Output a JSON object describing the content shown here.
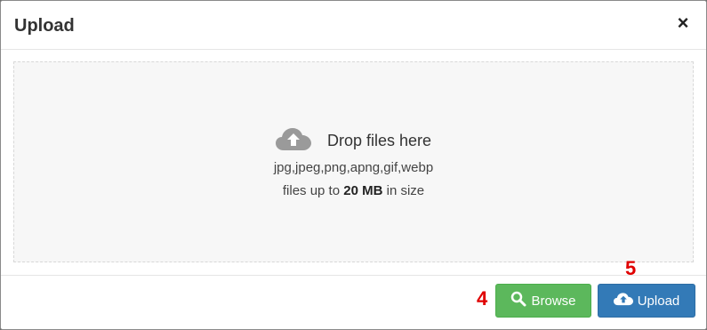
{
  "dialog": {
    "title": "Upload",
    "close_label": "×"
  },
  "dropzone": {
    "icon": "cloud-upload-icon",
    "title": "Drop files here",
    "formats": "jpg,jpeg,png,apng,gif,webp",
    "size_prefix": "files up to",
    "size_value": "20 MB",
    "size_suffix": "in size"
  },
  "buttons": {
    "browse_label": "Browse",
    "browse_icon": "search-icon",
    "browse_color": "#5cb85c",
    "upload_label": "Upload",
    "upload_icon": "cloud-upload-icon",
    "upload_color": "#337ab7"
  },
  "markers": {
    "browse_marker": "4",
    "upload_marker": "5",
    "marker_color": "#e00000"
  }
}
